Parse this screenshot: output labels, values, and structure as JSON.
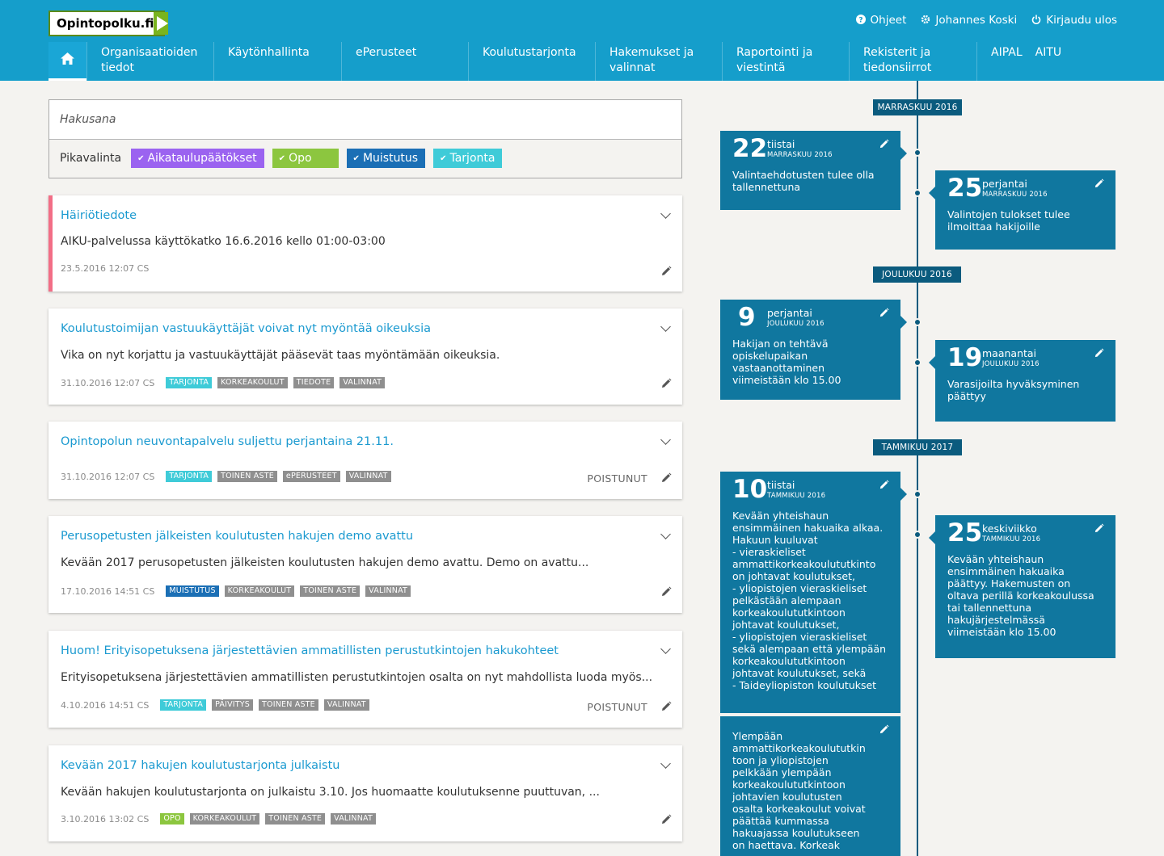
{
  "header": {
    "logo": "Opintopolku.fi",
    "links": [
      {
        "icon": "help-icon",
        "glyph": "?",
        "label": "Ohjeet"
      },
      {
        "icon": "gear-icon",
        "glyph": "⚙",
        "label": "Johannes Koski"
      },
      {
        "icon": "power-icon",
        "glyph": "⏻",
        "label": "Kirjaudu ulos"
      }
    ],
    "nav": [
      {
        "label": "Organisaatioiden\ntiedot"
      },
      {
        "label": "Käytönhallinta"
      },
      {
        "label": "ePerusteet"
      },
      {
        "label": "Koulutustarjonta"
      },
      {
        "label": "Hakemukset ja\nvalinnat"
      },
      {
        "label": "Raportointi ja\nviestintä"
      },
      {
        "label": "Rekisterit ja\ntiedonsiirrot"
      }
    ],
    "nav_last": [
      "AIPAL",
      "AITU"
    ]
  },
  "search": {
    "placeholder": "Hakusana",
    "quick_label": "Pikavalinta",
    "chips": [
      {
        "label": "Aikataulupäätökset",
        "color": "#9b63f0"
      },
      {
        "label": "Opo",
        "color": "#8cc63f"
      },
      {
        "label": "Muistutus",
        "color": "#1b6fb5"
      },
      {
        "label": "Tarjonta",
        "color": "#3fcbd8"
      }
    ]
  },
  "notices": [
    {
      "title": "Häiriötiedote",
      "body": "AIKU-palvelussa käyttökatko 16.6.2016 kello 01:00-03:00",
      "date": "23.5.2016 12:07 CS",
      "tags": [],
      "status": ""
    },
    {
      "title": "Koulutustoimijan vastuukäyttäjät voivat nyt myöntää oikeuksia",
      "body": "Vika on nyt korjattu ja vastuukäyttäjät pääsevät taas myöntämään oikeuksia.",
      "date": "31.10.2016 12:07 CS",
      "tags": [
        {
          "label": "TARJONTA",
          "kind": "tarjonta"
        },
        {
          "label": "KORKEAKOULUT",
          "kind": "grey"
        },
        {
          "label": "TIEDOTE",
          "kind": "grey"
        },
        {
          "label": "VALINNAT",
          "kind": "grey"
        }
      ],
      "status": ""
    },
    {
      "title": "Opintopolun neuvontapalvelu suljettu perjantaina 21.11.",
      "body": "",
      "date": "31.10.2016 12:07 CS",
      "tags": [
        {
          "label": "TARJONTA",
          "kind": "tarjonta"
        },
        {
          "label": "TOINEN ASTE",
          "kind": "grey"
        },
        {
          "label": "ePERUSTEET",
          "kind": "grey"
        },
        {
          "label": "VALINNAT",
          "kind": "grey"
        }
      ],
      "status": "POISTUNUT"
    },
    {
      "title": "Perusopetusten jälkeisten koulutusten hakujen demo avattu",
      "body": "Kevään 2017 perusopetusten jälkeisten koulutusten hakujen demo avattu. Demo on avattu...",
      "date": "17.10.2016 14:51 CS",
      "tags": [
        {
          "label": "MUISTUTUS",
          "kind": "muistutus"
        },
        {
          "label": "KORKEAKOULUT",
          "kind": "grey"
        },
        {
          "label": "TOINEN ASTE",
          "kind": "grey"
        },
        {
          "label": "VALINNAT",
          "kind": "grey"
        }
      ],
      "status": ""
    },
    {
      "title": "Huom! Erityisopetuksena järjestettävien ammatillisten perustutkintojen hakukohteet",
      "body": "Erityisopetuksena järjestettävien ammatillisten perustutkintojen osalta on nyt mahdollista luoda myös...",
      "date": "4.10.2016 14:51 CS",
      "tags": [
        {
          "label": "TARJONTA",
          "kind": "tarjonta"
        },
        {
          "label": "PÄIVITYS",
          "kind": "grey"
        },
        {
          "label": "TOINEN ASTE",
          "kind": "grey"
        },
        {
          "label": "VALINNAT",
          "kind": "grey"
        }
      ],
      "status": "POISTUNUT"
    },
    {
      "title": "Kevään 2017 hakujen koulutustarjonta julkaistu",
      "body": "Kevään hakujen koulutustarjonta on julkaistu 3.10. Jos huomaatte koulutuksenne puuttuvan, ...",
      "date": "3.10.2016 13:02 CS",
      "tags": [
        {
          "label": "OPO",
          "kind": "opo"
        },
        {
          "label": "KORKEAKOULUT",
          "kind": "grey"
        },
        {
          "label": "TOINEN ASTE",
          "kind": "grey"
        },
        {
          "label": "VALINNAT",
          "kind": "grey"
        }
      ],
      "status": ""
    }
  ],
  "timeline": {
    "months": [
      "MARRASKUU 2016",
      "JOULUKUU 2016",
      "TAMMIKUU 2017"
    ],
    "events": [
      {
        "day": "22",
        "weekday": "tiistai",
        "month": "MARRASKUU 2016",
        "text": "Valintaehdotusten tulee olla tallennettuna"
      },
      {
        "day": "25",
        "weekday": "perjantai",
        "month": "MARRASKUU 2016",
        "text": "Valintojen tulokset tulee ilmoittaa hakijoille"
      },
      {
        "day": "9",
        "weekday": "perjantai",
        "month": "JOULUKUU 2016",
        "text": "Hakijan on tehtävä\nopiskelupaikan\nvastaanottaminen\nviimeistään klo 15.00"
      },
      {
        "day": "19",
        "weekday": "maanantai",
        "month": "JOULUKUU 2016",
        "text": "Varasijoilta hyväksyminen päättyy"
      },
      {
        "day": "10",
        "weekday": "tiistai",
        "month": "TAMMIKUU 2016",
        "text": "Kevään yhteishaun\nensimmäinen hakuaika alkaa.\nHakuun kuuluvat\n- vieraskieliset\nammattikorkeakoulututkinto\non johtavat koulutukset,\n- yliopistojen vieraskieliset\npelkästään alempaan\nkorkeakoulututkintoon\njohtavat koulutukset,\n- yliopistojen vieraskieliset\nsekä alempaan että ylempään\nkorkeakoulututkintoon\njohtavat koulutukset, sekä\n- Taideyliopiston koulutukset"
      },
      {
        "day": "25",
        "weekday": "keskiviikko",
        "month": "TAMMIKUU 2016",
        "text": "Kevään yhteishaun\nensimmäinen hakuaika\npäättyy. Hakemusten on\noltava perillä korkeakoulussa\ntai tallennettuna\nhakujärjestelmässä\nviimeistään klo 15.00"
      },
      {
        "day": "",
        "weekday": "",
        "month": "",
        "text": "Ylempään\nammattikorkeakoulututkin\ntoon ja yliopistojen\npelkkään ylempään\nkorkeakoulututkintoon\njohtavien koulutusten\nosalta korkeakoulut voivat\npäättää kummassa\nhakuajassa koulutukseen\non haettava. Korkeak"
      }
    ]
  }
}
